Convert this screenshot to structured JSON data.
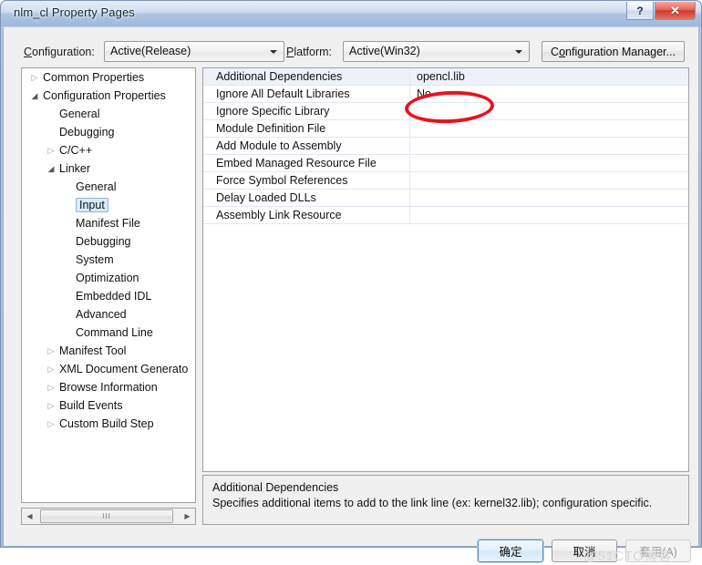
{
  "window": {
    "title": "nlm_cl Property Pages",
    "help_button": "?",
    "close_button": "✕"
  },
  "toolbar": {
    "configuration_label": "Configuration:",
    "configuration_label_mnemonic": "C",
    "configuration_value": "Active(Release)",
    "platform_label": "Platform:",
    "platform_label_mnemonic": "P",
    "platform_value": "Active(Win32)",
    "config_manager_label": "Configuration Manager...",
    "config_manager_mnemonic": "o"
  },
  "tree": {
    "nodes": [
      {
        "label": "Common Properties",
        "indent": 0,
        "state": "collapsed",
        "selected": false
      },
      {
        "label": "Configuration Properties",
        "indent": 0,
        "state": "expanded",
        "selected": false
      },
      {
        "label": "General",
        "indent": 1,
        "state": "leaf",
        "selected": false
      },
      {
        "label": "Debugging",
        "indent": 1,
        "state": "leaf",
        "selected": false
      },
      {
        "label": "C/C++",
        "indent": 1,
        "state": "collapsed",
        "selected": false
      },
      {
        "label": "Linker",
        "indent": 1,
        "state": "expanded",
        "selected": false
      },
      {
        "label": "General",
        "indent": 2,
        "state": "leaf",
        "selected": false
      },
      {
        "label": "Input",
        "indent": 2,
        "state": "leaf",
        "selected": true
      },
      {
        "label": "Manifest File",
        "indent": 2,
        "state": "leaf",
        "selected": false
      },
      {
        "label": "Debugging",
        "indent": 2,
        "state": "leaf",
        "selected": false
      },
      {
        "label": "System",
        "indent": 2,
        "state": "leaf",
        "selected": false
      },
      {
        "label": "Optimization",
        "indent": 2,
        "state": "leaf",
        "selected": false
      },
      {
        "label": "Embedded IDL",
        "indent": 2,
        "state": "leaf",
        "selected": false
      },
      {
        "label": "Advanced",
        "indent": 2,
        "state": "leaf",
        "selected": false
      },
      {
        "label": "Command Line",
        "indent": 2,
        "state": "leaf",
        "selected": false
      },
      {
        "label": "Manifest Tool",
        "indent": 1,
        "state": "collapsed",
        "selected": false
      },
      {
        "label": "XML Document Generato",
        "indent": 1,
        "state": "collapsed",
        "selected": false
      },
      {
        "label": "Browse Information",
        "indent": 1,
        "state": "collapsed",
        "selected": false
      },
      {
        "label": "Build Events",
        "indent": 1,
        "state": "collapsed",
        "selected": false
      },
      {
        "label": "Custom Build Step",
        "indent": 1,
        "state": "collapsed",
        "selected": false
      }
    ],
    "scrollbar": {
      "left_arrow": "◀",
      "right_arrow": "▶",
      "grip": "III"
    },
    "glyphs": {
      "collapsed": "▷",
      "expanded": "◢"
    }
  },
  "grid": {
    "rows": [
      {
        "name": "Additional Dependencies",
        "value": "opencl.lib"
      },
      {
        "name": "Ignore All Default Libraries",
        "value": "No"
      },
      {
        "name": "Ignore Specific Library",
        "value": ""
      },
      {
        "name": "Module Definition File",
        "value": ""
      },
      {
        "name": "Add Module to Assembly",
        "value": ""
      },
      {
        "name": "Embed Managed Resource File",
        "value": ""
      },
      {
        "name": "Force Symbol References",
        "value": ""
      },
      {
        "name": "Delay Loaded DLLs",
        "value": ""
      },
      {
        "name": "Assembly Link Resource",
        "value": ""
      }
    ]
  },
  "annotation": {
    "color": "#e8141c",
    "target": "opencl.lib"
  },
  "description": {
    "title": "Additional Dependencies",
    "body": "Specifies additional items to add to the link line (ex: kernel32.lib); configuration specific."
  },
  "buttons": {
    "ok": "确定",
    "cancel": "取消",
    "apply": "套用(A)"
  },
  "watermark": "@51CTO博客"
}
